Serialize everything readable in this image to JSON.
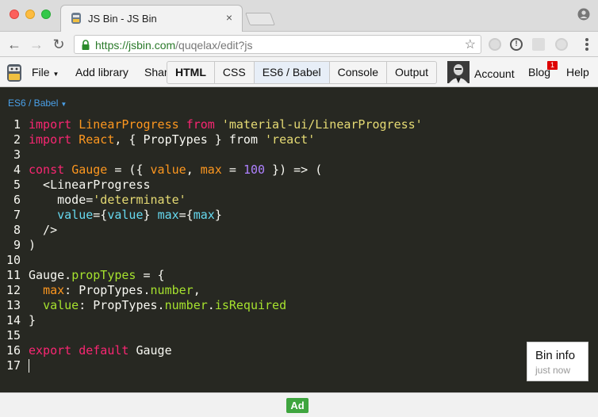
{
  "browser": {
    "tab_title": "JS Bin - JS Bin",
    "tab_close": "×",
    "url_secure": "https://jsbin.com",
    "url_path": "/quqelax/edit?js"
  },
  "jsbin": {
    "menu": {
      "file": "File",
      "add_library": "Add library",
      "share": "Share"
    },
    "panels": [
      {
        "label": "HTML"
      },
      {
        "label": "CSS"
      },
      {
        "label": "ES6 / Babel"
      },
      {
        "label": "Console"
      },
      {
        "label": "Output"
      }
    ],
    "account": "Account",
    "blog": "Blog",
    "blog_badge": "1",
    "help": "Help"
  },
  "editor": {
    "mode": "ES6 / Babel",
    "line_numbers": [
      "1",
      "2",
      "3",
      "4",
      "5",
      "6",
      "7",
      "8",
      "9",
      "10",
      "11",
      "12",
      "13",
      "14",
      "15",
      "16",
      "17"
    ]
  },
  "bin_info": {
    "title": "Bin info",
    "subtitle": "just now"
  },
  "footer": {
    "ad": "Ad"
  },
  "colors": {
    "editor_bg": "#272822",
    "keyword": "#f92672",
    "string": "#e6db74",
    "param": "#fd971f",
    "number": "#ae81ff",
    "class": "#a6e22e",
    "attr": "#66d9ef",
    "mode_label": "#4aa0e8",
    "ad_bg": "#3fa53f"
  }
}
